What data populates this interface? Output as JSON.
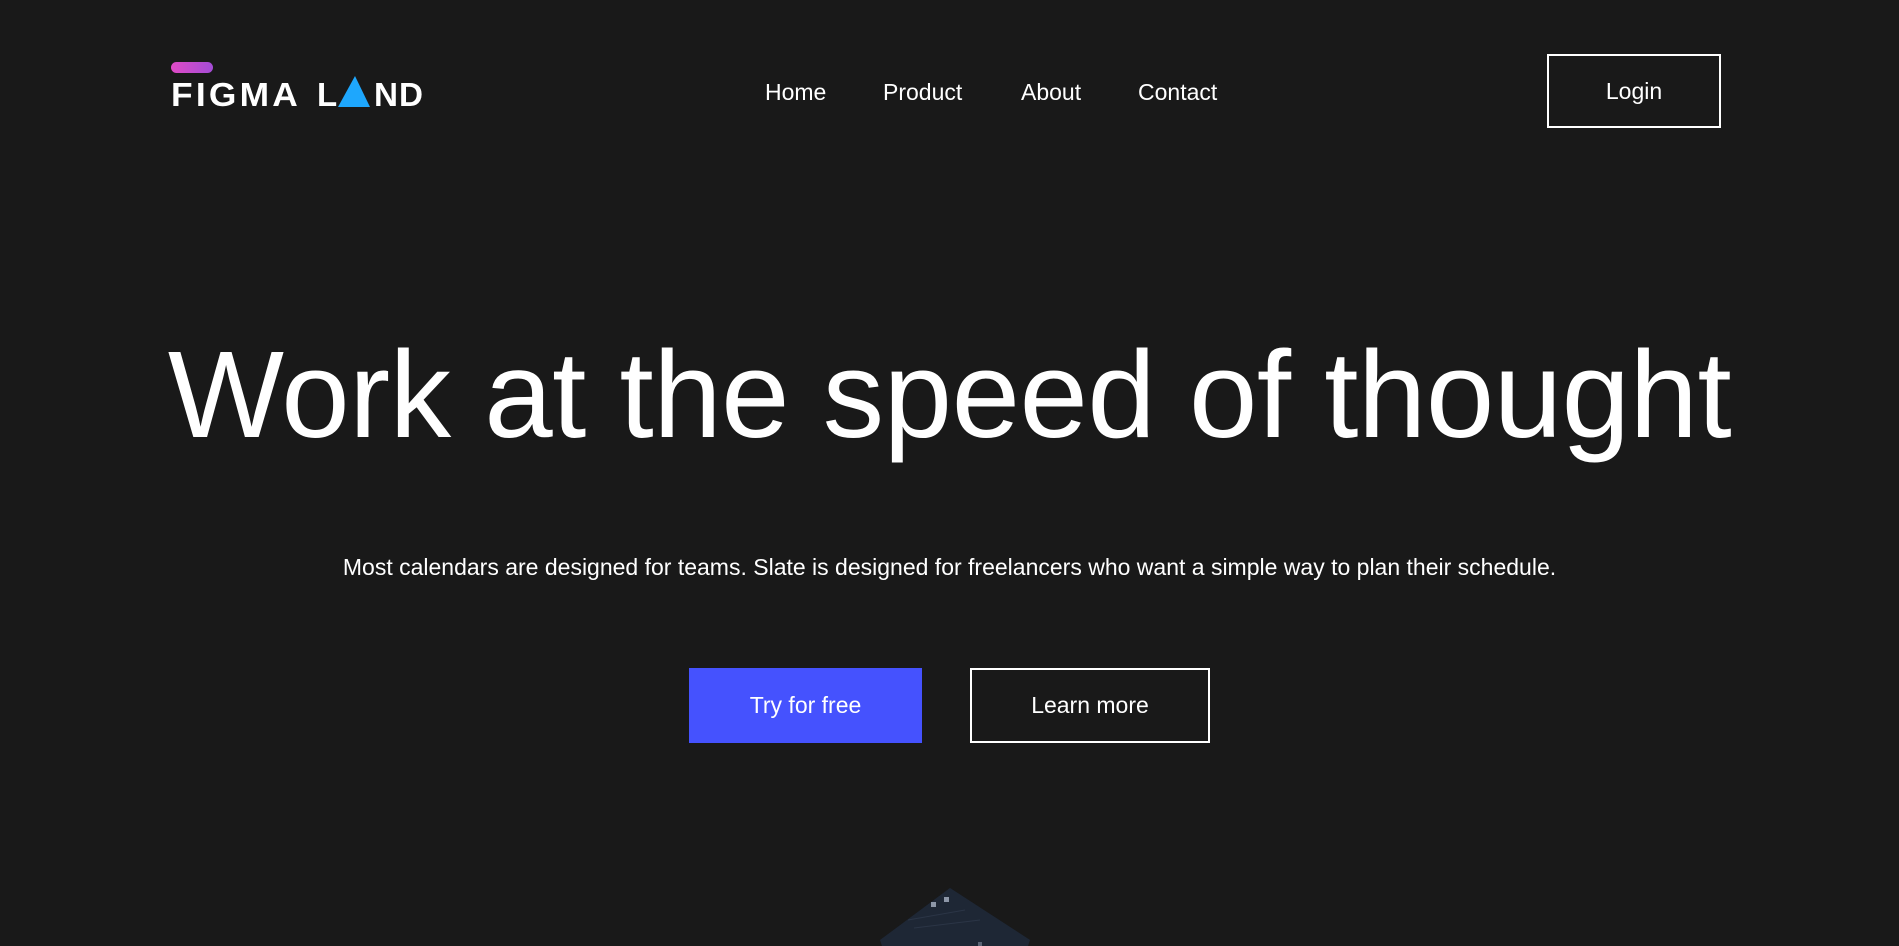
{
  "brand": {
    "logo_text": "FIGMA LAND",
    "colors": {
      "logo_pill_start": "#e04bc6",
      "logo_pill_end": "#a44cd6",
      "logo_triangle": "#1ea7fd"
    }
  },
  "nav": {
    "items": [
      {
        "label": "Home"
      },
      {
        "label": "Product"
      },
      {
        "label": "About"
      },
      {
        "label": "Contact"
      }
    ],
    "login_label": "Login"
  },
  "hero": {
    "title": "Work at the speed of thought",
    "subtitle": "Most calendars are designed for teams. Slate is designed for freelancers who want a simple way to plan their schedule.",
    "primary_cta": "Try for free",
    "secondary_cta": "Learn more"
  },
  "theme": {
    "background": "#191919",
    "text": "#ffffff",
    "primary_button": "#4552fe"
  }
}
